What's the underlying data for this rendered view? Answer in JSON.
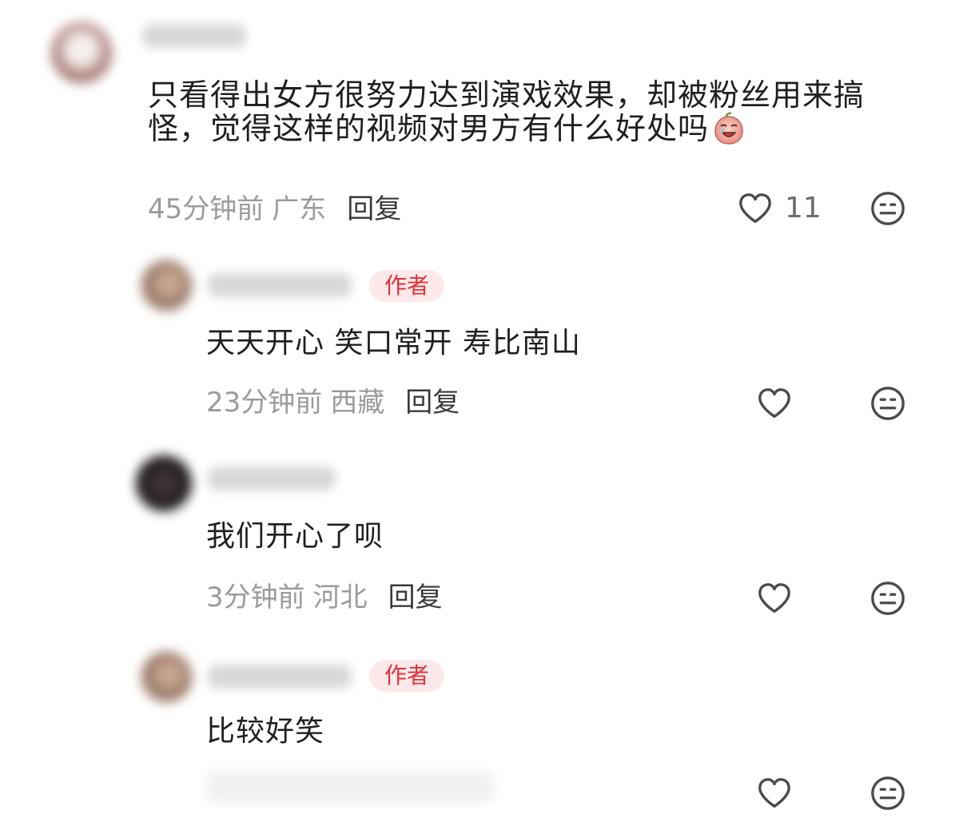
{
  "comments": [
    {
      "text_line1": "只看得出女方很努力达到演戏效果，却被粉丝用来搞",
      "text_line2": "怪，觉得这样的视频对男方有什么好处吗",
      "inline_emoji": "crying-face-sticker",
      "time": "45分钟前",
      "region": "广东",
      "reply_label": "回复",
      "like_count": "11"
    },
    {
      "badge": "作者",
      "text": "天天开心 笑口常开 寿比南山",
      "time": "23分钟前",
      "region": "西藏",
      "reply_label": "回复"
    },
    {
      "text": "我们开心了呗",
      "time": "3分钟前",
      "region": "河北",
      "reply_label": "回复"
    },
    {
      "badge": "作者",
      "text": "比较好笑"
    }
  ],
  "icons": {
    "like": "heart-outline-icon",
    "dislike": "neutral-face-icon"
  },
  "colors": {
    "author_badge_text": "#e0313b",
    "author_badge_bg": "#fde9ea",
    "meta_gray": "#9b9b9b"
  }
}
